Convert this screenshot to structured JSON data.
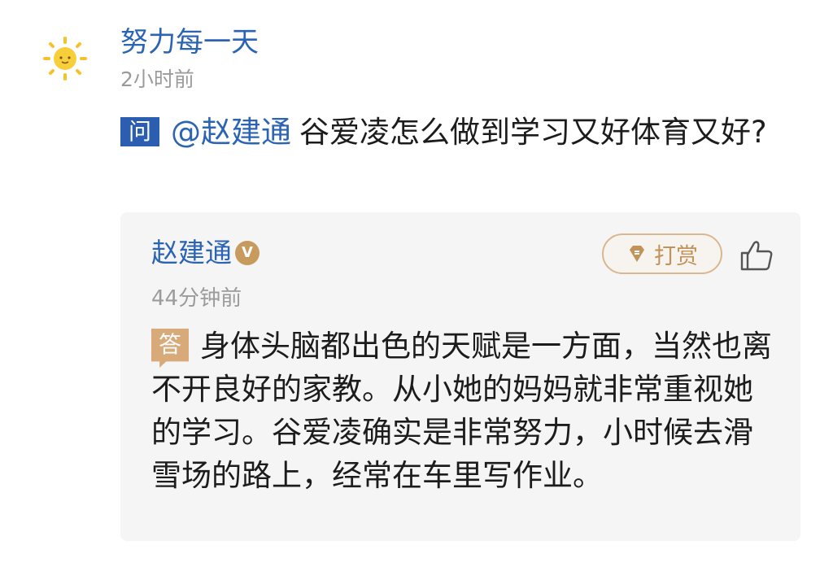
{
  "post": {
    "username": "努力每一天",
    "time": "2小时前",
    "question_badge": "问",
    "mention": "@赵建通",
    "question_text": "谷爱凌怎么做到学习又好体育又好?"
  },
  "answer": {
    "author": "赵建通",
    "verified_badge": "V",
    "tip_label": "打赏",
    "time": "44分钟前",
    "answer_badge": "答",
    "text": "身体头脑都出色的天赋是一方面，当然也离不开良好的家教。从小她的妈妈就非常重视她的学习。谷爱凌确实是非常努力，小时候去滑雪场的路上，经常在车里写作业。"
  },
  "colors": {
    "link_blue": "#2b64b3",
    "question_badge": "#2b5db0",
    "answer_badge": "#d8aa7a",
    "tip_gold": "#c29259",
    "card_bg": "#f5f5f5"
  },
  "icons": {
    "avatar": "sun-avatar-icon",
    "tip": "diamond-tip-icon",
    "like": "thumbs-up-icon"
  }
}
